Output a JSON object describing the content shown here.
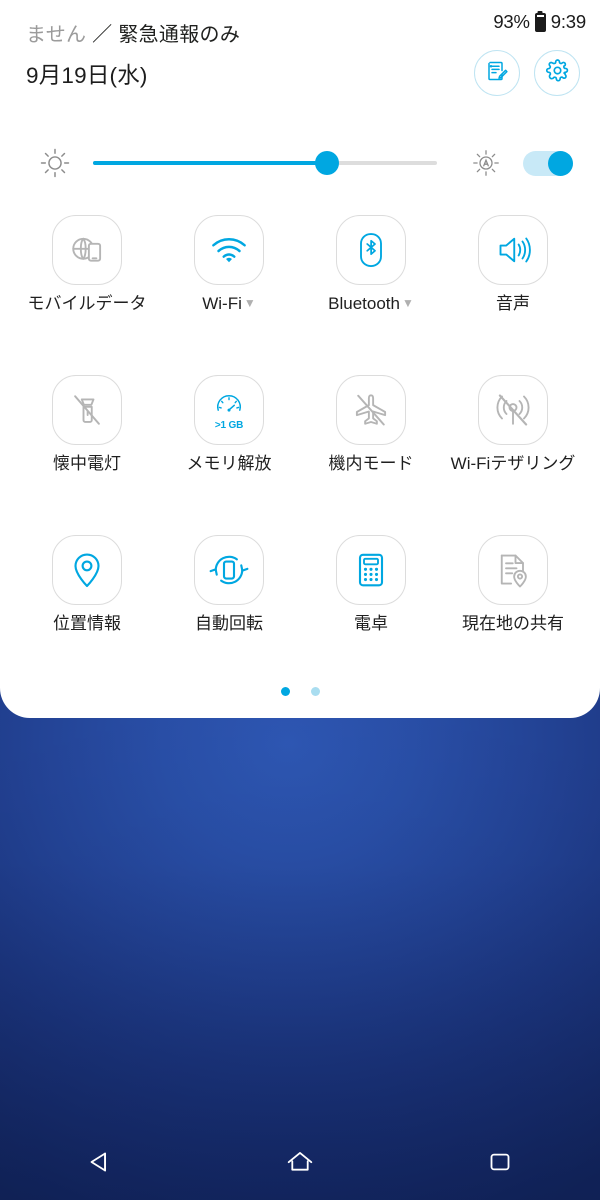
{
  "statusbar": {
    "battery_percent": "93%",
    "time": "9:39",
    "battery_icon": "battery-icon"
  },
  "header": {
    "carrier_faded": "ません",
    "carrier_rest": " ／ 緊急通報のみ",
    "date": "9月19日(水)",
    "edit_button": "edit-notes-icon",
    "settings_button": "gear-icon"
  },
  "brightness": {
    "icon": "brightness-sun-icon",
    "value_percent": 68,
    "auto_icon": "auto-brightness-icon",
    "auto_enabled": true
  },
  "tiles": [
    {
      "label": "モバイルデータ",
      "icon": "mobile-data-icon",
      "enabled": false,
      "has_caret": false
    },
    {
      "label": "Wi-Fi",
      "icon": "wifi-icon",
      "enabled": true,
      "has_caret": true
    },
    {
      "label": "Bluetooth",
      "icon": "bluetooth-icon",
      "enabled": true,
      "has_caret": true
    },
    {
      "label": "音声",
      "icon": "sound-icon",
      "enabled": true,
      "has_caret": false
    },
    {
      "label": "懐中電灯",
      "icon": "flashlight-off-icon",
      "enabled": false,
      "has_caret": false
    },
    {
      "label": "メモリ解放",
      "icon": "memory-clean-icon",
      "enabled": true,
      "has_caret": false,
      "badge": ">1 GB"
    },
    {
      "label": "機内モード",
      "icon": "airplane-mode-icon",
      "enabled": false,
      "has_caret": false
    },
    {
      "label": "Wi-Fiテザリング",
      "icon": "wifi-tethering-off-icon",
      "enabled": false,
      "has_caret": false
    },
    {
      "label": "位置情報",
      "icon": "location-pin-icon",
      "enabled": true,
      "has_caret": false
    },
    {
      "label": "自動回転",
      "icon": "auto-rotate-icon",
      "enabled": true,
      "has_caret": false
    },
    {
      "label": "電卓",
      "icon": "calculator-icon",
      "enabled": true,
      "has_caret": false
    },
    {
      "label": "現在地の共有",
      "icon": "share-location-icon",
      "enabled": false,
      "has_caret": false
    }
  ],
  "pager": {
    "total": 2,
    "active_index": 0
  },
  "navbar": {
    "back": "back-triangle-icon",
    "home": "home-icon",
    "recents": "recents-square-icon"
  },
  "colors": {
    "accent": "#00a7e1",
    "accent_light": "#a9ddf0",
    "disabled": "#b5b5b5",
    "panel_bg": "#ffffff",
    "wallpaper_top": "#1e3a88"
  }
}
